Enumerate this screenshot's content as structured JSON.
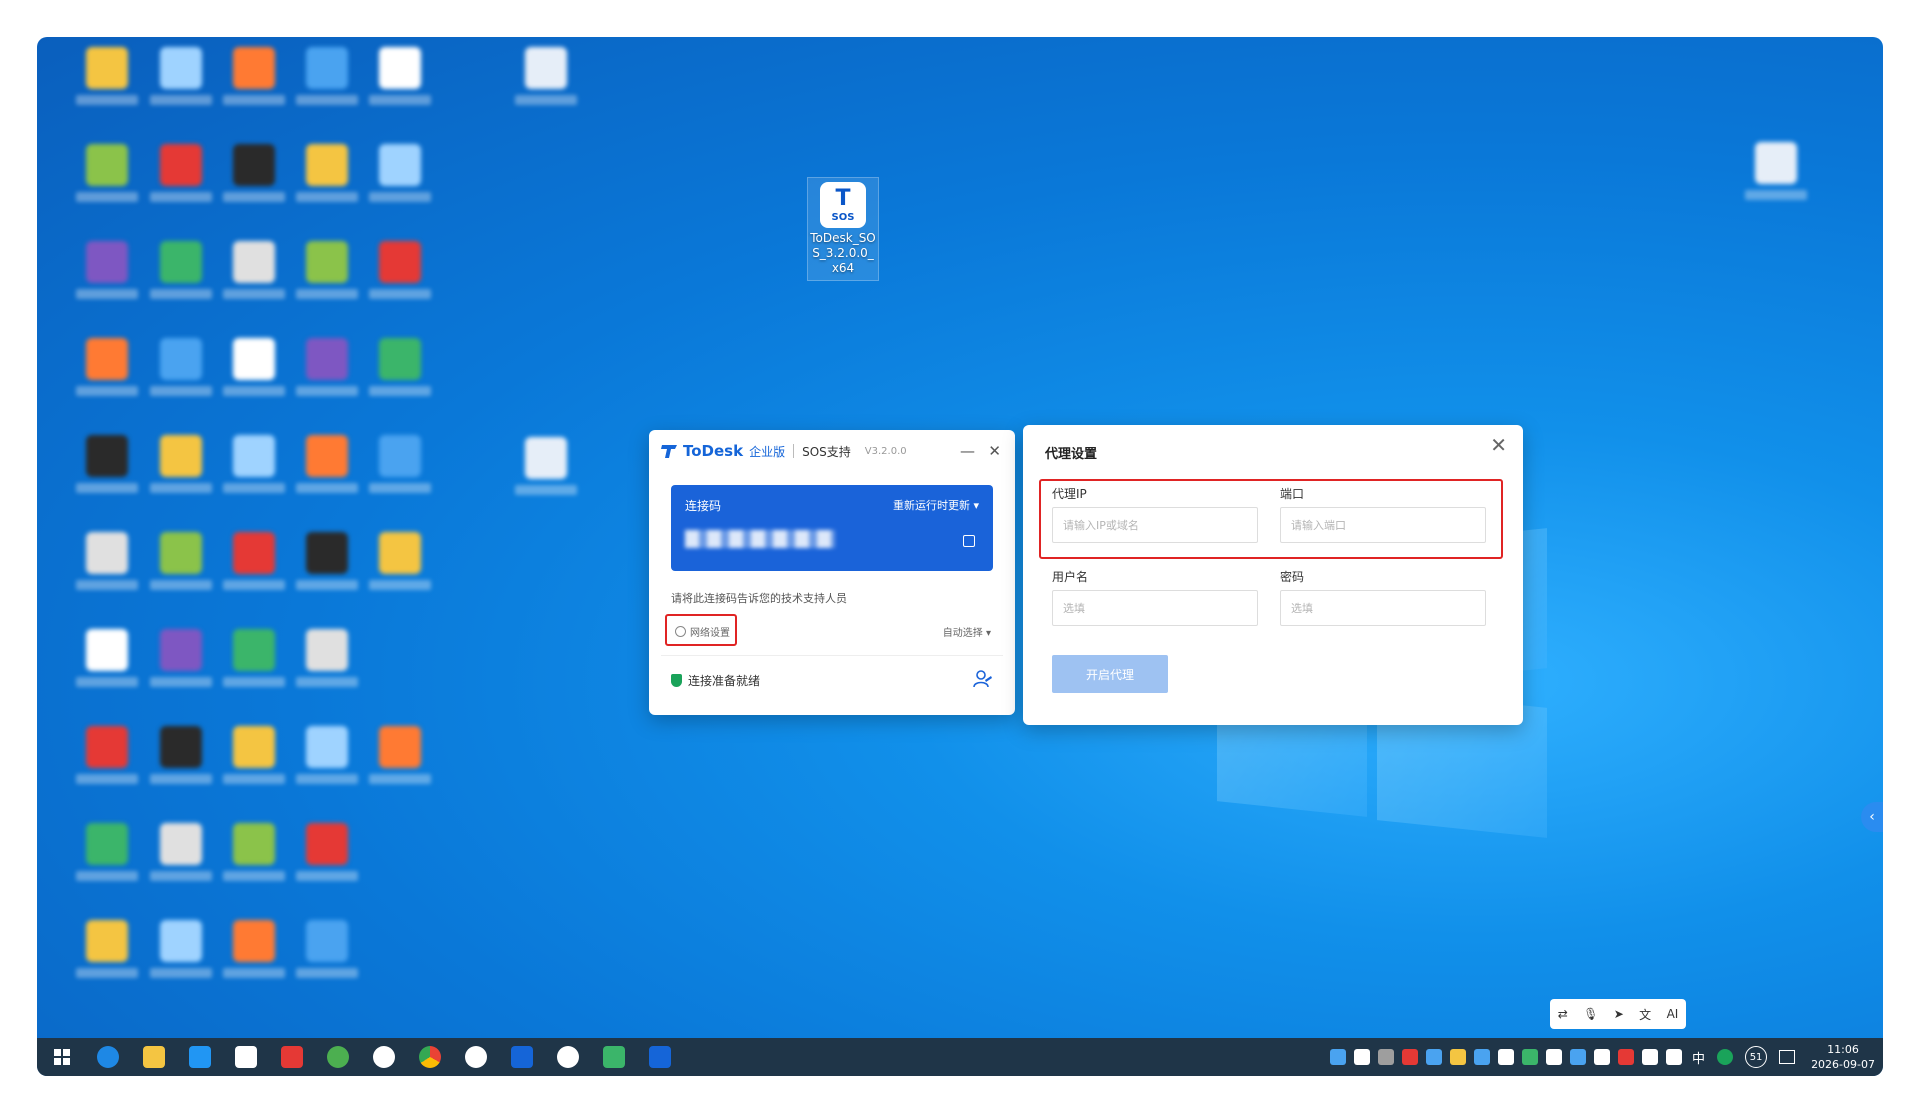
{
  "desktop": {
    "todesk_shortcut_label": "ToDesk_SOS_3.2.0.0_x64",
    "todesk_logo_text": "SOS"
  },
  "todesk_window": {
    "brand": "ToDesk",
    "edition": "企业版",
    "mode": "SOS支持",
    "version": "V3.2.0.0",
    "minimize_glyph": "—",
    "close_glyph": "✕",
    "connection_code_title": "连接码",
    "refresh_label": "重新运行时更新 ▾",
    "tip_text": "请将此连接码告诉您的技术支持人员",
    "network_settings_label": "网络设置",
    "auto_select_label": "自动选择 ▾",
    "status_text": "连接准备就绪"
  },
  "proxy_panel": {
    "title": "代理设置",
    "close_glyph": "✕",
    "proxy_ip_label": "代理IP",
    "proxy_ip_placeholder": "请输入IP或域名",
    "port_label": "端口",
    "port_placeholder": "请输入端口",
    "username_label": "用户名",
    "username_placeholder": "选填",
    "password_label": "密码",
    "password_placeholder": "选填",
    "enable_button": "开启代理"
  },
  "ime_toolbar": {
    "items": [
      "⇄",
      "🎙",
      "➤",
      "文",
      "AI"
    ]
  },
  "taskbar": {
    "ime_lang": "中",
    "notification_count": "51",
    "time": "11:06",
    "date": "2026-09-07"
  },
  "colors": {
    "accent": "#1a63d9",
    "highlight_box": "#e02424",
    "ready_green": "#1aa35a",
    "taskbar": "#1f3548"
  }
}
